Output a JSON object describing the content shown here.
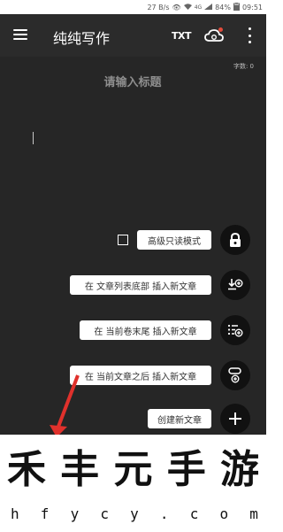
{
  "status_bar": {
    "speed": "27 B/s",
    "network": "4G",
    "battery": "84%",
    "time": "09:51"
  },
  "toolbar": {
    "title": "纯纯写作",
    "txt_label": "TXT",
    "icons": [
      "menu-icon",
      "cloud-icon",
      "more-vert-icon"
    ]
  },
  "editor": {
    "word_count": "字数: 0",
    "title_placeholder": "请输入标题"
  },
  "fab_menu": [
    {
      "label": "高级只读模式",
      "icon": "lock-icon"
    },
    {
      "label": "在 文章列表底部 插入新文章",
      "icon": "insert-bottom-icon"
    },
    {
      "label": "在 当前卷末尾 插入新文章",
      "icon": "insert-volume-end-icon"
    },
    {
      "label": "在 当前文章之后 插入新文章",
      "icon": "insert-after-icon"
    },
    {
      "label": "创建新文章",
      "icon": "plus-icon"
    }
  ],
  "watermark": {
    "chars": [
      "禾",
      "丰",
      "元",
      "手",
      "游"
    ],
    "url": [
      "h",
      "f",
      "y",
      "c",
      "y",
      ".",
      "c",
      "o",
      "m"
    ]
  },
  "colors": {
    "toolbar_bg": "#2b2b2b",
    "editor_bg": "#262626",
    "fab_bg": "#111111",
    "notification_dot": "#e24b3b",
    "arrow": "#e0312c"
  }
}
